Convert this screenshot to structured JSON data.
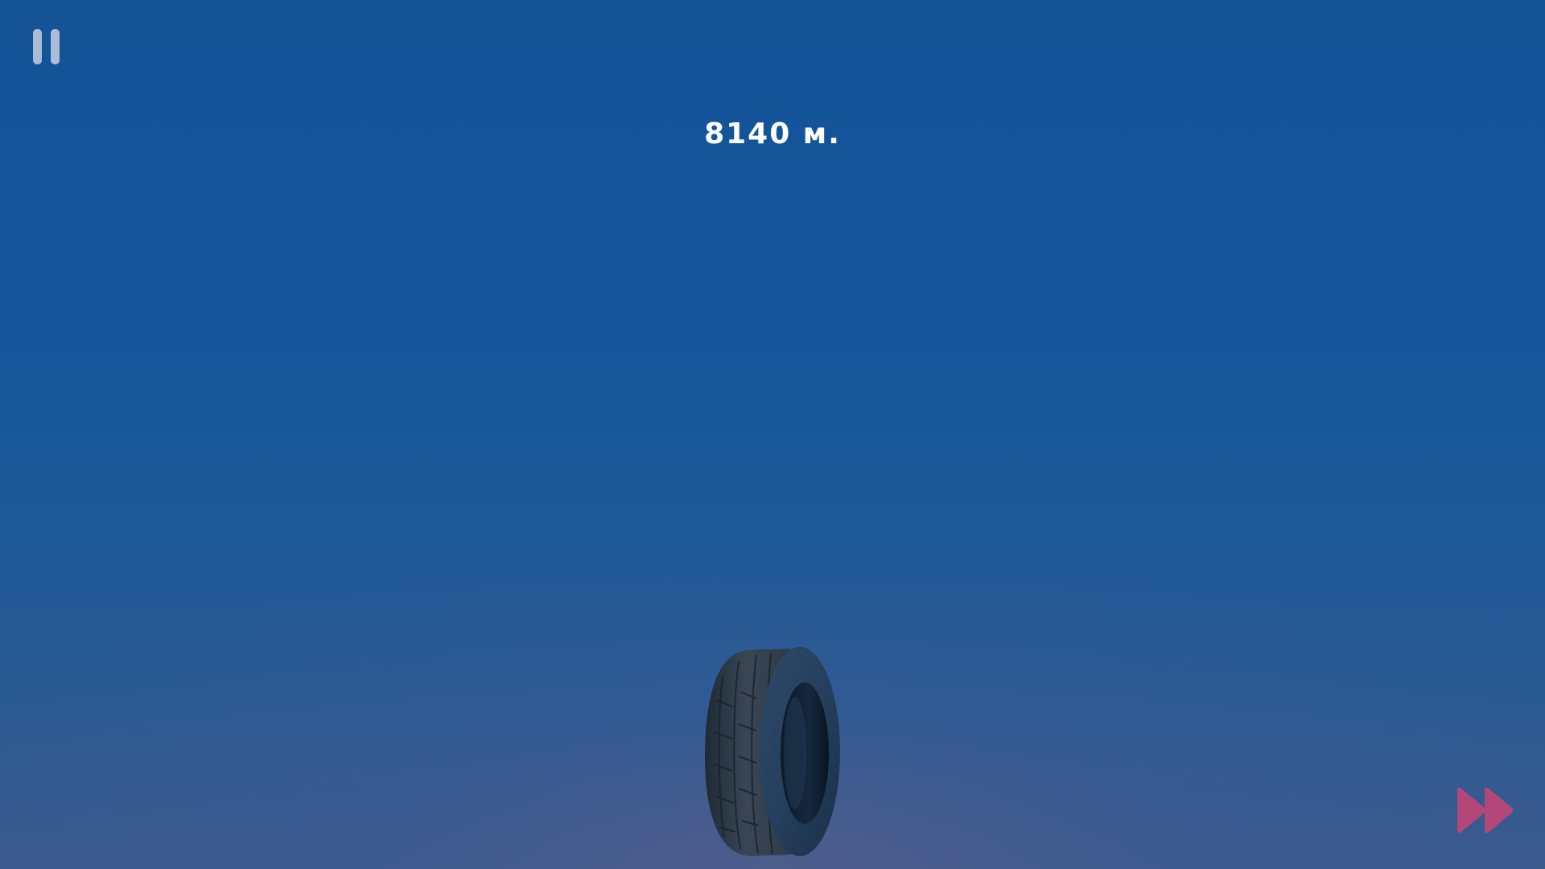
{
  "hud": {
    "distance_text": "8140 м."
  },
  "icons": {
    "pause": "pause-icon",
    "fast_forward": "fast-forward-icon",
    "player": "tire"
  },
  "colors": {
    "sky_top": "#135396",
    "sky_bottom": "#3a5a8c",
    "pause_icon": "#b9c6db",
    "fast_forward_icon": "#b4477a",
    "distance_text": "#ffffff"
  }
}
